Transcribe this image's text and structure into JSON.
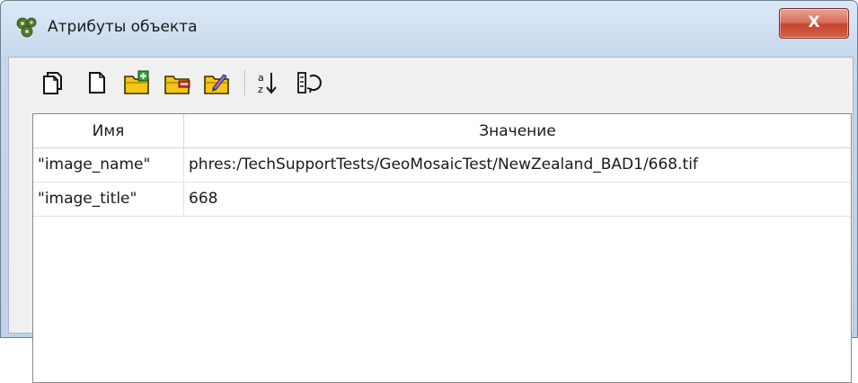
{
  "window": {
    "title": "Атрибуты объекта",
    "close_label": "X",
    "icon": "gear-cluster-icon"
  },
  "toolbar": {
    "buttons": [
      {
        "name": "copy-icon"
      },
      {
        "name": "new-document-icon"
      },
      {
        "name": "folder-add-icon"
      },
      {
        "name": "folder-remove-icon"
      },
      {
        "name": "folder-edit-icon"
      },
      {
        "name": "sort-az-icon"
      },
      {
        "name": "refresh-list-icon"
      }
    ]
  },
  "table": {
    "columns": [
      "Имя",
      "Значение"
    ],
    "rows": [
      {
        "name": "\"image_name\"",
        "value": "phres:/TechSupportTests/GeoMosaicTest/NewZealand_BAD1/668.tif"
      },
      {
        "name": "\"image_title\"",
        "value": "668"
      }
    ]
  },
  "colors": {
    "titlebar_gradient_top": "#dbe8f6",
    "close_button": "#c5432f",
    "folder_yellow": "#f5c518",
    "folder_green": "#2fa336",
    "folder_red": "#d9342b"
  }
}
